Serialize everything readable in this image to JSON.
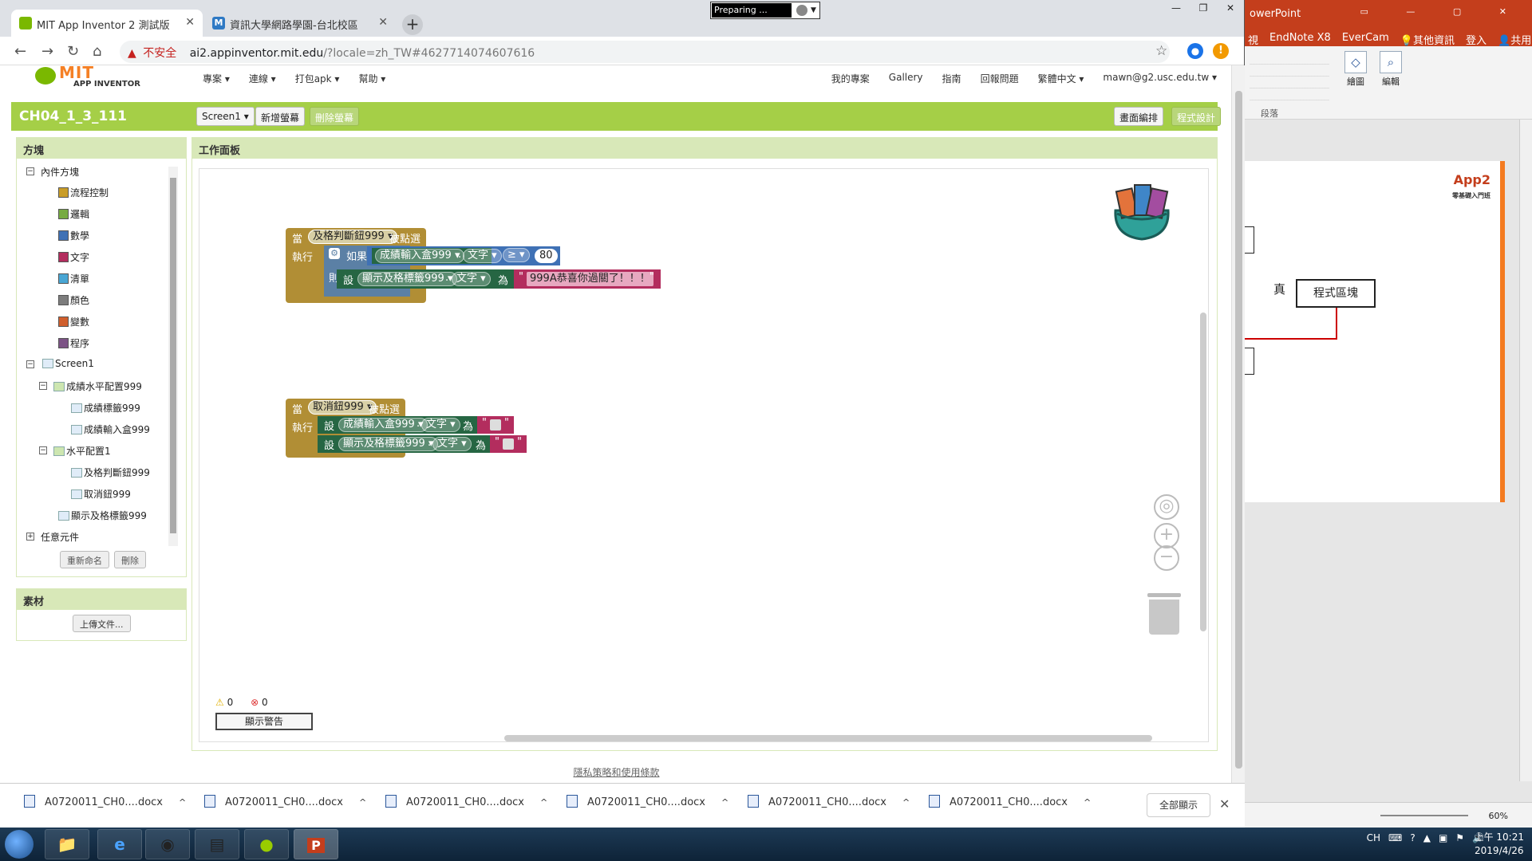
{
  "ppt": {
    "title": "owerPoint",
    "menu": [
      "視",
      "EndNote X8",
      "EverCam",
      "其他資訊",
      "登入",
      "共用"
    ],
    "ribbon": {
      "draw": "繪圖",
      "edit": "編輯",
      "group_label": "段落"
    },
    "slide": {
      "logo_main": "App2",
      "logo_sub": "零基礎入門班",
      "true_label": "真",
      "box_label": "程式區塊"
    },
    "zoom": "60%"
  },
  "recording": {
    "label": "Preparing ..."
  },
  "tabs": [
    {
      "title": "MIT App Inventor 2 測試版",
      "fav_color": "#7ab800"
    },
    {
      "title": "資訊大學網路學園-台北校區",
      "fav_color": "#2e79c4"
    }
  ],
  "address": {
    "insecure_label": "不安全",
    "host": "ai2.appinventor.mit.edu",
    "path": "/?locale=zh_TW#4627714074607616"
  },
  "header": {
    "logo_mit": "MIT",
    "logo_sub": "APP INVENTOR",
    "menu": [
      "專案 ▾",
      "連線 ▾",
      "打包apk ▾",
      "幫助 ▾"
    ],
    "right": [
      "我的專案",
      "Gallery",
      "指南",
      "回報問題",
      "繁體中文 ▾",
      "mawn@g2.usc.edu.tw ▾"
    ]
  },
  "project": {
    "name": "CH04_1_3_111",
    "screen_select": "Screen1 ▾",
    "add_screen": "新增螢幕",
    "remove_screen": "刪除螢幕",
    "designer": "畫面編排",
    "blocks": "程式設計"
  },
  "blocks_panel": {
    "title": "方塊",
    "builtin": "內件方塊",
    "categories": [
      {
        "label": "流程控制",
        "color": "#c99d28"
      },
      {
        "label": "邏輯",
        "color": "#77ab41"
      },
      {
        "label": "數學",
        "color": "#3f71b5"
      },
      {
        "label": "文字",
        "color": "#b32d5e"
      },
      {
        "label": "清單",
        "color": "#49a6d4"
      },
      {
        "label": "顏色",
        "color": "#7d7d7d"
      },
      {
        "label": "變數",
        "color": "#d05f2d"
      },
      {
        "label": "程序",
        "color": "#7c5385"
      }
    ],
    "screen": "Screen1",
    "components": {
      "hbox1": "成績水平配置999",
      "label1": "成績標籤999",
      "textbox1": "成績輸入盒999",
      "hbox2": "水平配置1",
      "btn1": "及格判斷鈕999",
      "btn2": "取消鈕999",
      "label2": "顯示及格標籤999"
    },
    "any_component": "任意元件",
    "rename": "重新命名",
    "delete": "刪除"
  },
  "media_panel": {
    "title": "素材",
    "upload": "上傳文件..."
  },
  "workspace": {
    "title": "工作面板",
    "block1": {
      "when": "當",
      "component": "及格判斷鈕999 ▾",
      "event": "被點選",
      "do": "執行",
      "if": "如果",
      "then": "則",
      "cond_component": "成績輸入盒999 ▾",
      "cond_prop": "文字 ▾",
      "op": "≥ ▾",
      "num": "80",
      "set": "設",
      "set_component": "顯示及格標籤999 ▾",
      "set_prop": "文字 ▾",
      "to": "為",
      "str_value": "999A恭喜你過關了！！！"
    },
    "block2": {
      "when": "當",
      "component": "取消鈕999 ▾",
      "event": "被點選",
      "do": "執行",
      "set": "設",
      "to": "為",
      "set1_component": "成績輸入盒999 ▾",
      "set1_prop": "文字 ▾",
      "set2_component": "顯示及格標籤999 ▾",
      "set2_prop": "文字 ▾"
    },
    "quote_open": "\"",
    "quote_close": "\"",
    "warnings": {
      "warn_count": "0",
      "error_count": "0",
      "show": "顯示警告"
    }
  },
  "footer": {
    "privacy": "隱私策略和使用條款"
  },
  "downloads": {
    "items": [
      "A0720011_CH0....docx",
      "A0720011_CH0....docx",
      "A0720011_CH0....docx",
      "A0720011_CH0....docx",
      "A0720011_CH0....docx",
      "A0720011_CH0....docx"
    ],
    "show_all": "全部顯示"
  },
  "taskbar": {
    "lang": "CH",
    "time": "上午 10:21",
    "date": "2019/4/26"
  }
}
